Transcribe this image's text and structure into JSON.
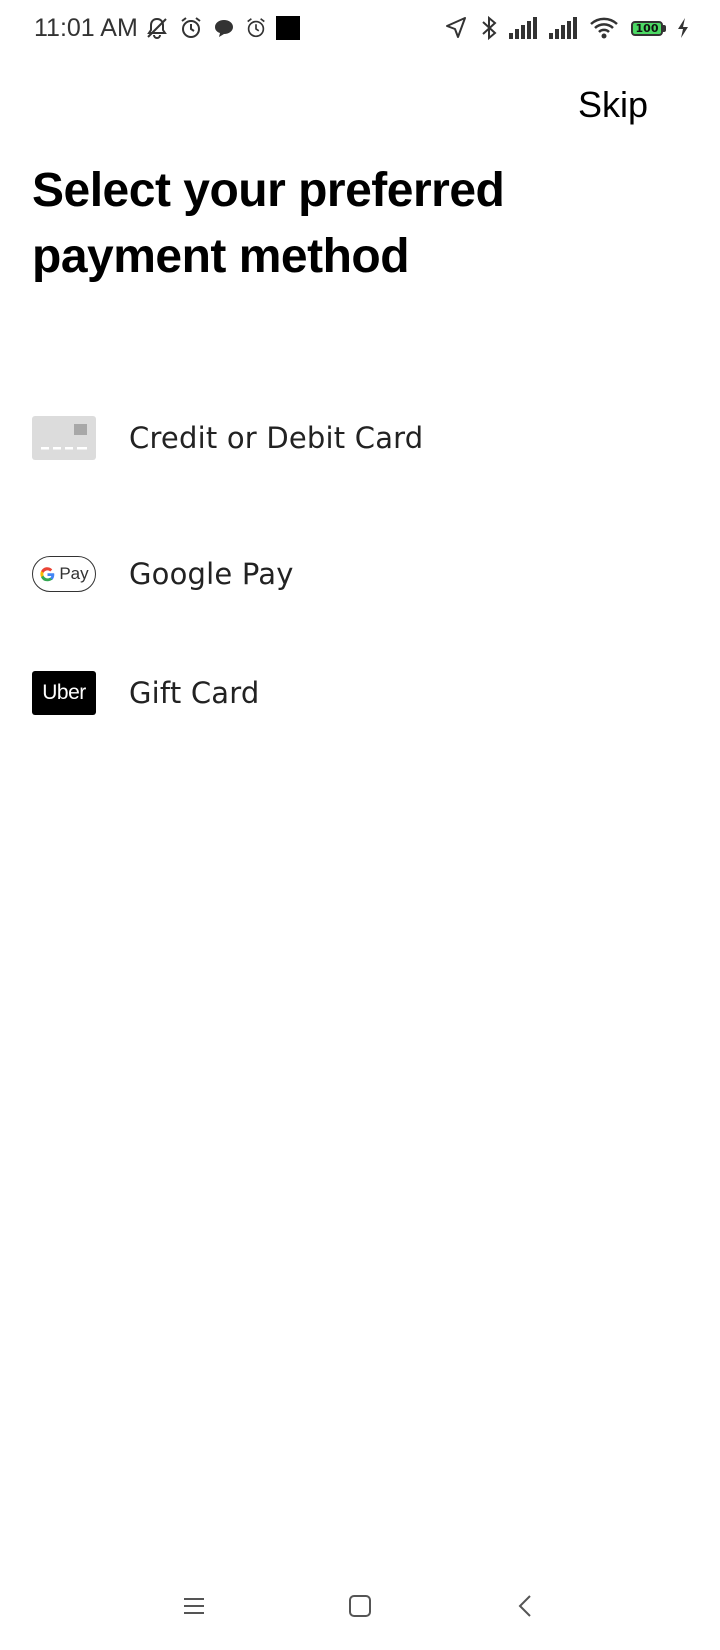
{
  "status_bar": {
    "time": "11:01 AM",
    "left_icons": [
      "muted-notifications-icon",
      "alarm-icon",
      "chat-bubble-icon",
      "alarm-icon",
      "black-square-icon"
    ],
    "right_icons": [
      "location-arrow-icon",
      "bluetooth-icon",
      "signal-icon",
      "signal-icon",
      "wifi-icon",
      "battery-icon",
      "charging-icon"
    ],
    "battery_level": "100"
  },
  "header": {
    "skip_label": "Skip"
  },
  "main": {
    "title": "Select your preferred payment method",
    "options": [
      {
        "label": "Credit or Debit Card",
        "icon": "credit-card-icon"
      },
      {
        "label": "Google Pay",
        "icon": "google-pay-icon",
        "icon_text": "Pay"
      },
      {
        "label": "Gift Card",
        "icon": "uber-icon",
        "icon_text": "Uber"
      }
    ]
  },
  "nav_bar": {
    "buttons": [
      "menu-icon",
      "home-icon",
      "back-icon"
    ]
  },
  "colors": {
    "background": "#ffffff",
    "text": "#000000",
    "card_icon_bg": "#dcdcdc",
    "battery_fill": "#4cd964",
    "uber_bg": "#000000"
  }
}
